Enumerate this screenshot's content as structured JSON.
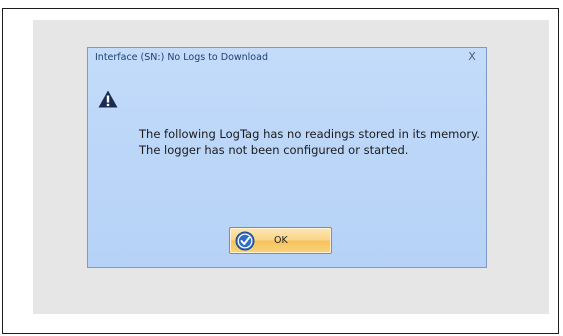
{
  "dialog": {
    "title": "Interface (SN:) No Logs to Download",
    "close_glyph": "X",
    "icon": "warning-icon",
    "message_line1": "The following LogTag has no readings stored in its memory.",
    "message_line2": "The logger has not been configured or started.",
    "ok_label": "OK",
    "ok_icon": "checkmark-circle-icon"
  },
  "colors": {
    "dialog_background": "#bdd7f9",
    "dialog_border": "#7d9ac6",
    "title_text": "#1e3f73",
    "button_highlight": "#fbd587",
    "button_border": "#c08324",
    "backdrop": "#e6e6e6"
  }
}
